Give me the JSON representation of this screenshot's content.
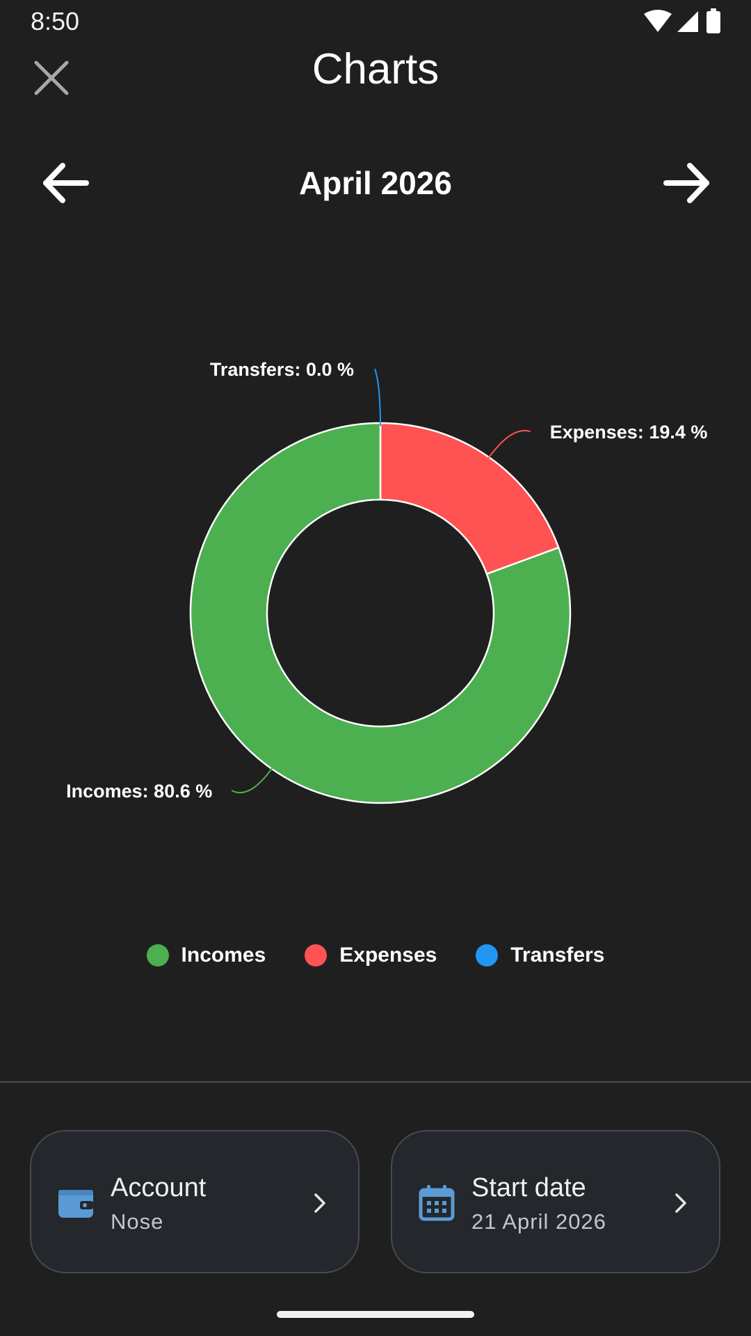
{
  "status_bar": {
    "time": "8:50",
    "icons": [
      "wifi-icon",
      "signal-icon",
      "battery-icon"
    ]
  },
  "app_bar": {
    "title": "Charts",
    "close_icon": "close-icon"
  },
  "month_nav": {
    "label": "April 2026",
    "prev_icon": "arrow-left-icon",
    "next_icon": "arrow-right-icon"
  },
  "chart_data": {
    "type": "pie",
    "style": "donut",
    "categories": [
      "Incomes",
      "Expenses",
      "Transfers"
    ],
    "values": [
      80.6,
      19.4,
      0.0
    ],
    "colors": [
      "#4caf50",
      "#ff5252",
      "#2196f3"
    ],
    "labels": [
      "Incomes: 80.6 %",
      "Expenses: 19.4 %",
      "Transfers: 0.0 %"
    ],
    "legend_position": "bottom"
  },
  "legend": [
    {
      "label": "Incomes",
      "color": "#4caf50"
    },
    {
      "label": "Expenses",
      "color": "#ff5252"
    },
    {
      "label": "Transfers",
      "color": "#2196f3"
    }
  ],
  "cards": {
    "account": {
      "title": "Account",
      "value": "Nose",
      "icon": "wallet-icon",
      "icon_color": "#5b9bd5"
    },
    "start_date": {
      "title": "Start date",
      "value": "21 April 2026",
      "icon": "calendar-icon",
      "icon_color": "#5b9bd5"
    }
  }
}
